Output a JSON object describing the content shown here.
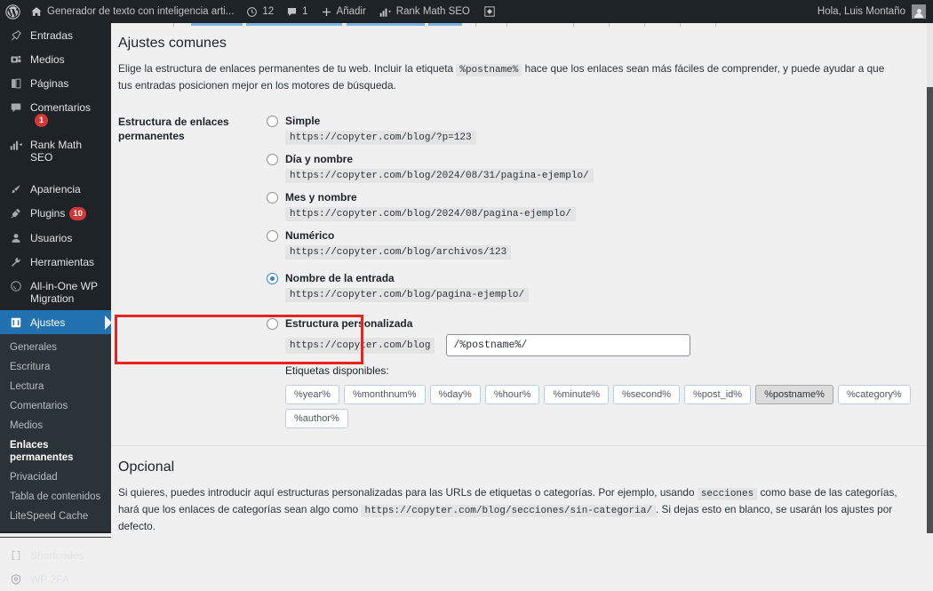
{
  "adminbar": {
    "wp_logo": "wordpress-logo-icon",
    "site_name": "Generador de texto con inteligencia arti...",
    "updates_count": "12",
    "comments_count": "1",
    "add_new_label": "Añadir",
    "rank_math_label": "Rank Math SEO",
    "howdy": "Hola, Luis Montaño"
  },
  "sidebar": {
    "items": [
      {
        "label": "Entradas",
        "icon": "pin-icon",
        "badge": ""
      },
      {
        "label": "Medios",
        "icon": "camera-icon",
        "badge": ""
      },
      {
        "label": "Páginas",
        "icon": "page-icon",
        "badge": ""
      },
      {
        "label": "Comentarios",
        "icon": "comment-icon",
        "badge": "1"
      },
      {
        "label": "Rank Math SEO",
        "icon": "bar-chart-icon",
        "badge": ""
      },
      {
        "label": "Apariencia",
        "icon": "brush-icon",
        "badge": ""
      },
      {
        "label": "Plugins",
        "icon": "plug-icon",
        "badge": "10"
      },
      {
        "label": "Usuarios",
        "icon": "user-icon",
        "badge": ""
      },
      {
        "label": "Herramientas",
        "icon": "wrench-icon",
        "badge": ""
      },
      {
        "label": "All-in-One WP Migration",
        "icon": "migration-icon",
        "badge": ""
      },
      {
        "label": "Ajustes",
        "icon": "settings-icon",
        "badge": ""
      }
    ],
    "submenu": [
      "Generales",
      "Escritura",
      "Lectura",
      "Comentarios",
      "Medios",
      "Enlaces permanentes",
      "Privacidad",
      "Tabla de contenidos",
      "LiteSpeed Cache"
    ],
    "submenu_current": "Enlaces permanentes",
    "bottom_items": [
      {
        "label": "Shortcodes",
        "icon": "brackets-icon"
      },
      {
        "label": "WP 2FA",
        "icon": "shield-lock-icon"
      }
    ]
  },
  "main": {
    "common_settings_title": "Ajustes comunes",
    "description_part1": "Elige la estructura de enlaces permanentes de tu web. Incluir la etiqueta",
    "description_code": "%postname%",
    "description_part2": "hace que los enlaces sean más fáciles de comprender, y puede ayudar a que tus entradas posicionen mejor en los motores de búsqueda.",
    "field_label": "Estructura de enlaces permanentes",
    "options": [
      {
        "label": "Simple",
        "url": "https://copyter.com/blog/?p=123",
        "selected": false
      },
      {
        "label": "Día y nombre",
        "url": "https://copyter.com/blog/2024/08/31/pagina-ejemplo/",
        "selected": false
      },
      {
        "label": "Mes y nombre",
        "url": "https://copyter.com/blog/2024/08/pagina-ejemplo/",
        "selected": false
      },
      {
        "label": "Numérico",
        "url": "https://copyter.com/blog/archivos/123",
        "selected": false
      },
      {
        "label": "Nombre de la entrada",
        "url": "https://copyter.com/blog/pagina-ejemplo/",
        "selected": true
      }
    ],
    "custom": {
      "label": "Estructura personalizada",
      "prefix": "https://copyter.com/blog",
      "input_value": "/%postname%/",
      "selected": false
    },
    "tags_label": "Etiquetas disponibles:",
    "tags": [
      {
        "label": "%year%",
        "active": false
      },
      {
        "label": "%monthnum%",
        "active": false
      },
      {
        "label": "%day%",
        "active": false
      },
      {
        "label": "%hour%",
        "active": false
      },
      {
        "label": "%minute%",
        "active": false
      },
      {
        "label": "%second%",
        "active": false
      },
      {
        "label": "%post_id%",
        "active": false
      },
      {
        "label": "%postname%",
        "active": true
      },
      {
        "label": "%category%",
        "active": false
      },
      {
        "label": "%author%",
        "active": false
      }
    ],
    "optional_title": "Opcional",
    "optional_part1": "Si quieres, puedes introducir aquí estructuras personalizadas para las URLs de etiquetas o categorías. Por ejemplo, usando",
    "optional_code1": "secciones",
    "optional_part2": "como base de las categorías, hará que los enlaces de categorías sean algo como",
    "optional_code2": "https://copyter.com/blog/secciones/sin-categoria/",
    "optional_part3": ". Si dejas esto en blanco, se usarán los ajustes por defecto."
  },
  "colors": {
    "admin_dark": "#1d2327",
    "accent_blue": "#2271b1",
    "highlight_red": "#e8231f",
    "badge_red": "#d63638"
  }
}
